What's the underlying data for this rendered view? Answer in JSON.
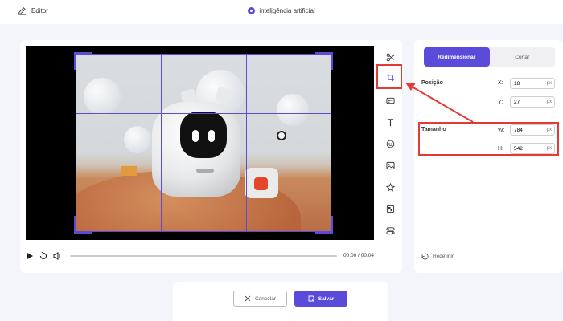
{
  "header": {
    "editor_label": "Editor",
    "project_name": "inteligência artificial"
  },
  "player": {
    "current_time": "00:00",
    "separator": "/",
    "duration": "00:04",
    "progress": 0
  },
  "toolbar": {
    "tools": [
      "scissors-icon",
      "crop-icon",
      "subtitles-icon",
      "text-icon",
      "emoji-icon",
      "image-icon",
      "star-icon",
      "mosaic-icon",
      "toggle-icon"
    ],
    "active_tool": "crop-icon"
  },
  "panel": {
    "tabs": [
      {
        "label": "Redimensionar",
        "active": true
      },
      {
        "label": "Cortar",
        "active": false
      }
    ],
    "position": {
      "label": "Posição",
      "x_label": "X:",
      "x_value": "18",
      "y_label": "Y:",
      "y_value": "27",
      "unit": "px"
    },
    "size": {
      "label": "Tamanho",
      "w_label": "W:",
      "w_value": "784",
      "h_label": "H:",
      "h_value": "542",
      "unit": "px"
    },
    "reset_label": "Redefinir"
  },
  "footer": {
    "cancel_label": "Cancelar",
    "save_label": "Salvar"
  },
  "colors": {
    "accent": "#5b4bdb",
    "highlight": "#e53935"
  }
}
